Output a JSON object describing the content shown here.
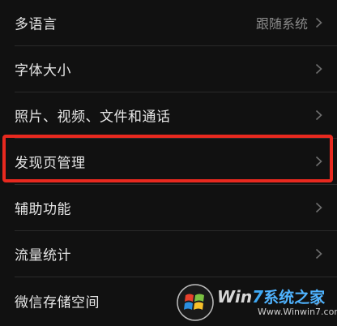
{
  "settings": {
    "items": [
      {
        "label": "多语言",
        "value": "跟随系统"
      },
      {
        "label": "字体大小",
        "value": ""
      },
      {
        "label": "照片、视频、文件和通话",
        "value": ""
      },
      {
        "label": "发现页管理",
        "value": "",
        "highlighted": true
      },
      {
        "label": "辅助功能",
        "value": ""
      },
      {
        "label": "流量统计",
        "value": ""
      },
      {
        "label": "微信存储空间",
        "value": ""
      }
    ]
  },
  "watermark": {
    "brand_prefix": "Win",
    "brand_seven": "7",
    "brand_cn": "系统之家",
    "url": "Www.Winwin7.com"
  },
  "colors": {
    "background": "#111111",
    "text": "#e6e6e6",
    "secondary_text": "#8a8a8a",
    "highlight_border": "#e8291f"
  }
}
